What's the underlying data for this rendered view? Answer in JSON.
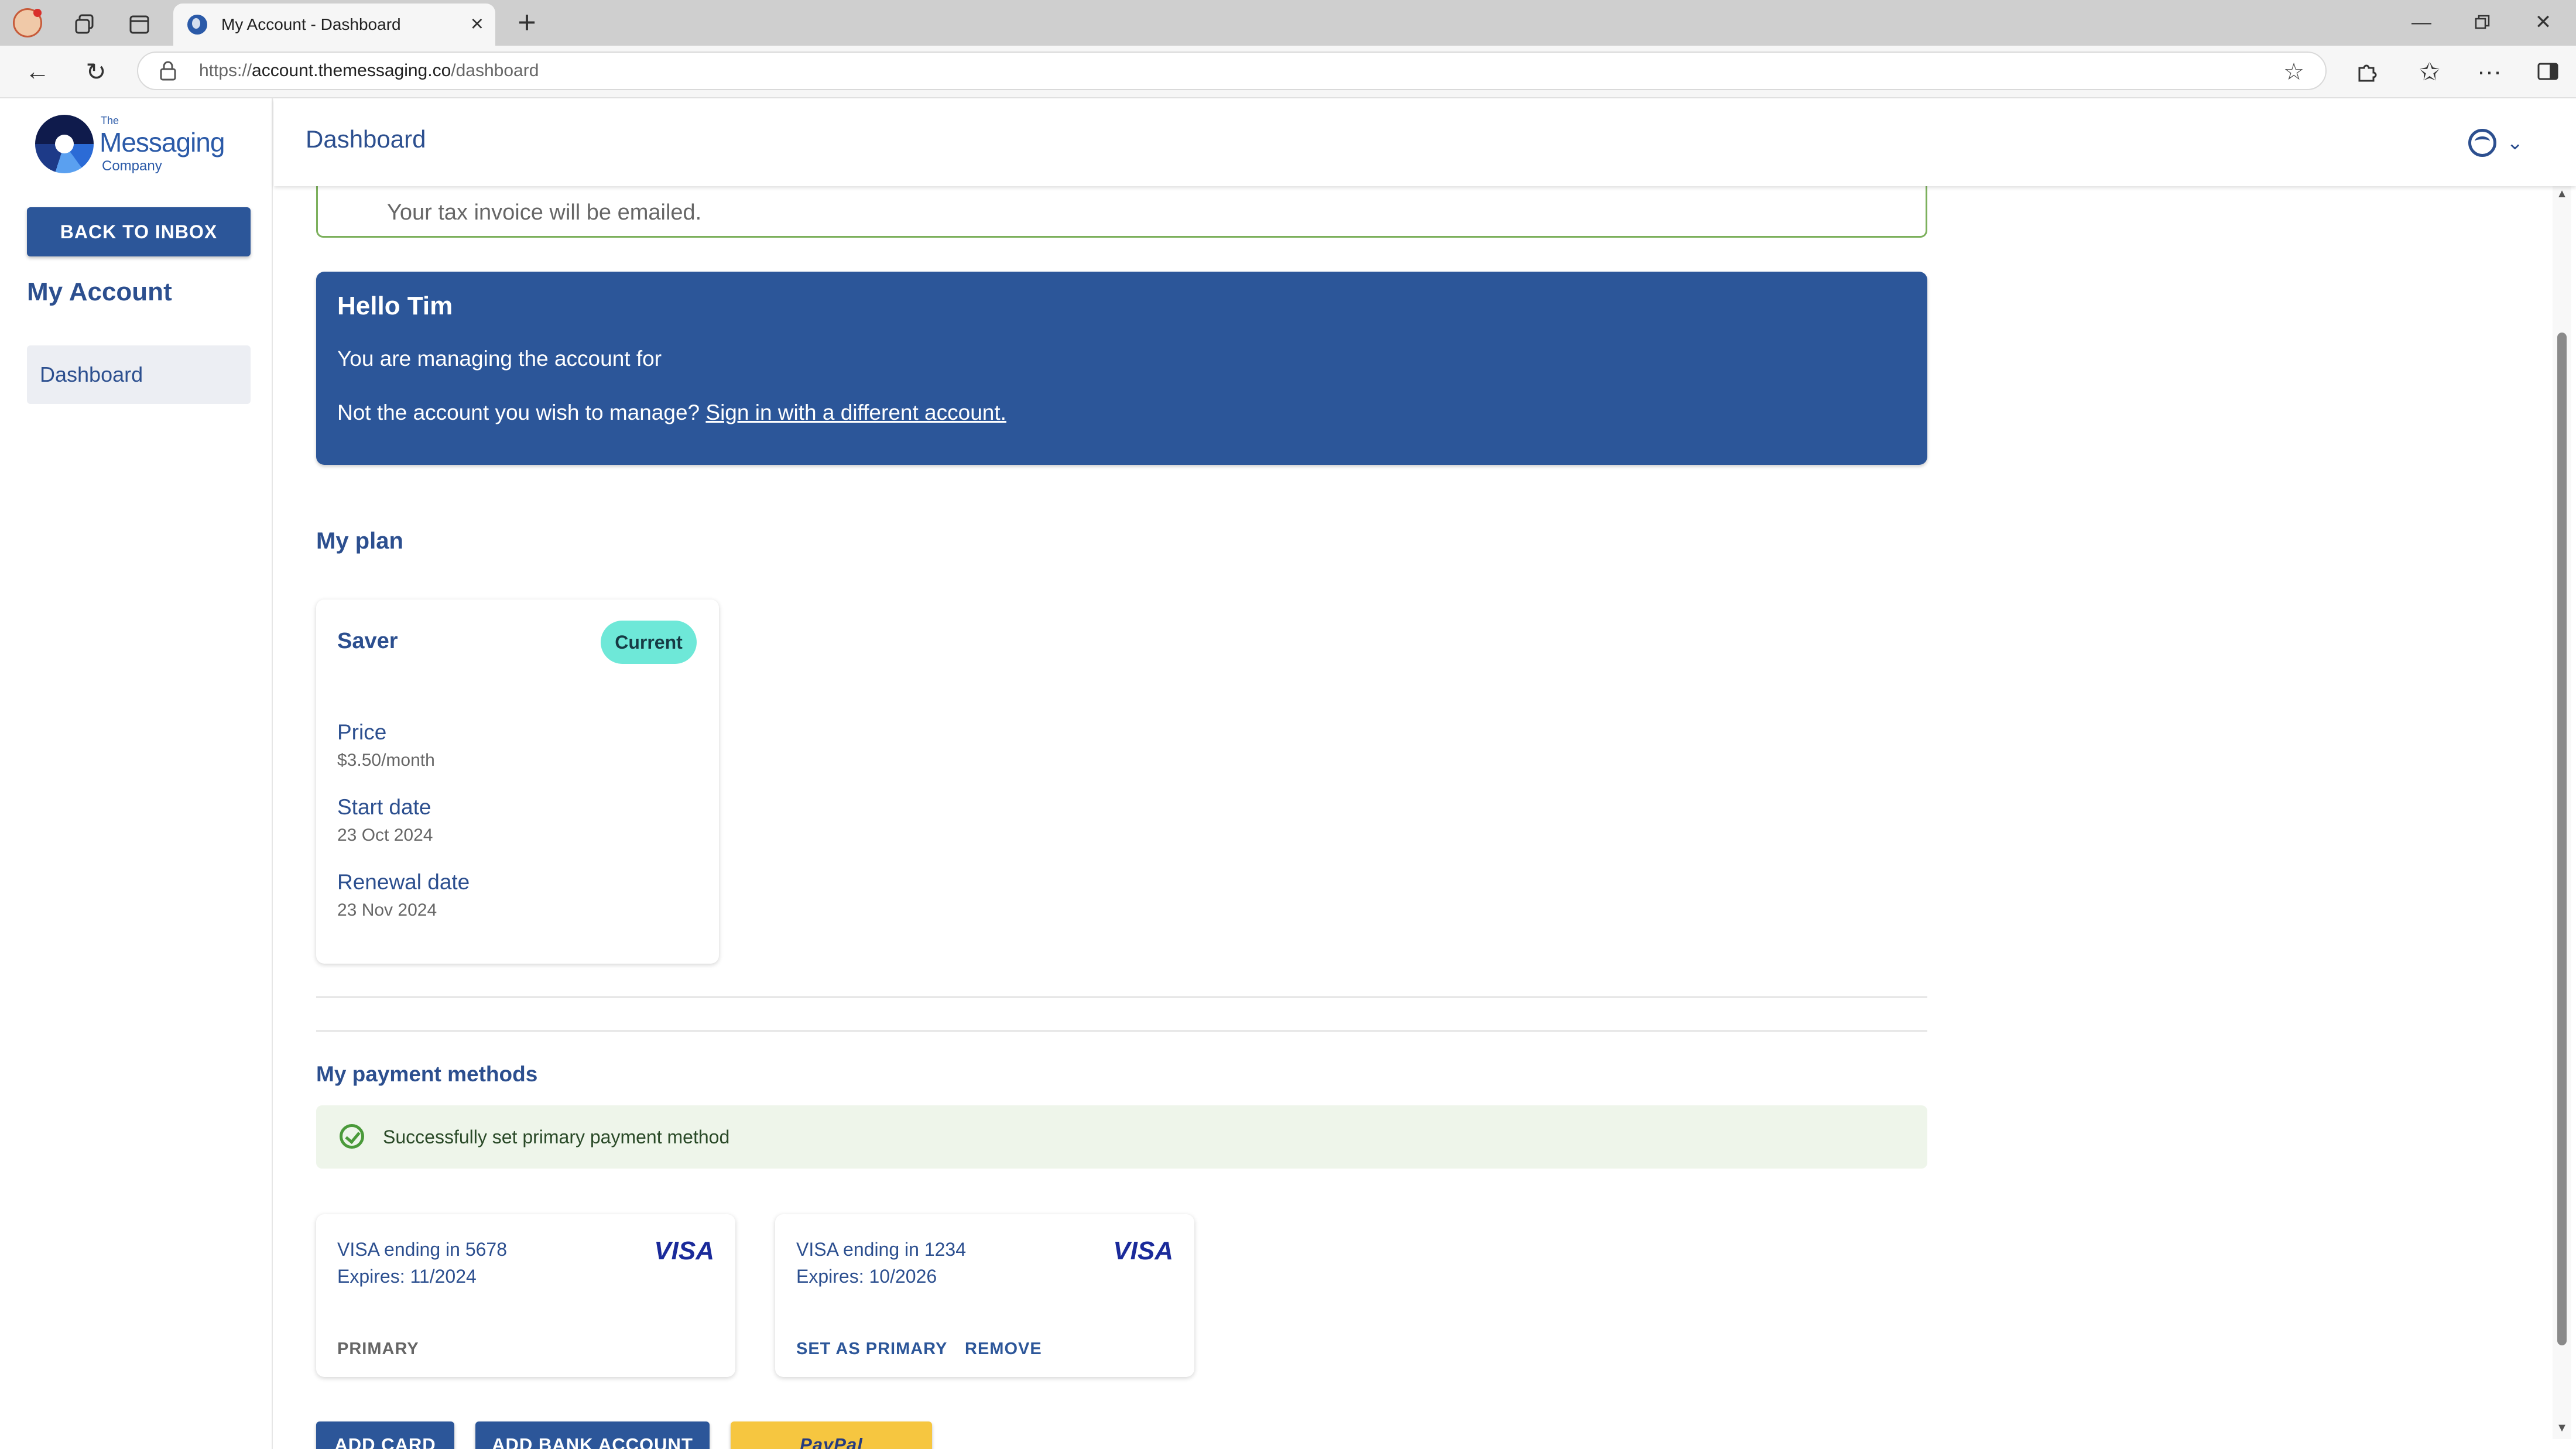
{
  "browser": {
    "tab_title": "My Account - Dashboard",
    "url_prefix": "https://",
    "url_domain": "account.themessaging.co",
    "url_path": "/dashboard"
  },
  "logo": {
    "line1": "The",
    "line2": "Messaging",
    "line3": "Company"
  },
  "sidebar": {
    "back_button": "BACK TO INBOX",
    "heading": "My Account",
    "items": [
      {
        "label": "Dashboard"
      }
    ]
  },
  "header": {
    "title": "Dashboard"
  },
  "tax_notice": "Your tax invoice will be emailed.",
  "greeting": {
    "title": "Hello Tim",
    "managing_line": "You are managing the account for",
    "switch_prompt": "Not the account you wish to manage?",
    "switch_link": "Sign in with a different account."
  },
  "plan": {
    "section_title": "My plan",
    "name": "Saver",
    "badge": "Current",
    "price_label": "Price",
    "price_value": "$3.50/month",
    "start_label": "Start date",
    "start_value": "23 Oct 2024",
    "renewal_label": "Renewal date",
    "renewal_value": "23 Nov 2024"
  },
  "payments": {
    "section_title": "My payment methods",
    "success_message": "Successfully set primary payment method",
    "cards": [
      {
        "name": "VISA ending in 5678",
        "expires": "Expires: 11/2024",
        "brand": "VISA",
        "action1": "PRIMARY"
      },
      {
        "name": "VISA ending in 1234",
        "expires": "Expires: 10/2026",
        "brand": "VISA",
        "action1": "SET AS PRIMARY",
        "action2": "REMOVE"
      }
    ],
    "buttons": {
      "add_card": "ADD CARD",
      "add_bank": "ADD BANK ACCOUNT",
      "paypal": "PayPal"
    }
  },
  "colors": {
    "primary": "#2c5699",
    "badge": "#6ee8d8",
    "success_bg": "#eef5ea",
    "paypal": "#f6c640"
  }
}
